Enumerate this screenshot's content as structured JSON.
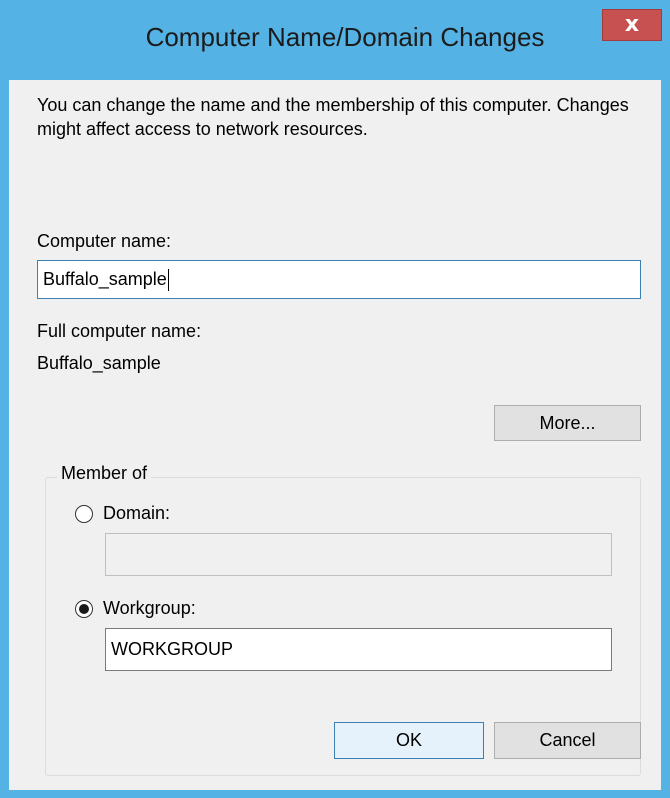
{
  "window": {
    "title": "Computer Name/Domain Changes",
    "close_glyph": "x"
  },
  "description": "You can change the name and the membership of this computer. Changes might affect access to network resources.",
  "computer_name": {
    "label": "Computer name:",
    "value": "Buffalo_sample"
  },
  "full_computer_name": {
    "label": "Full computer name:",
    "value": "Buffalo_sample"
  },
  "more_button": {
    "label": "More..."
  },
  "member_of": {
    "caption": "Member of",
    "domain": {
      "label": "Domain:",
      "selected": false,
      "value": ""
    },
    "workgroup": {
      "label": "Workgroup:",
      "selected": true,
      "value": "WORKGROUP"
    }
  },
  "buttons": {
    "ok_label": "OK",
    "cancel_label": "Cancel"
  },
  "colors": {
    "titlebar": "#55b2e4",
    "close_button": "#c75050",
    "client_background": "#f0f0f0",
    "focus_border": "#3c7fb1"
  }
}
